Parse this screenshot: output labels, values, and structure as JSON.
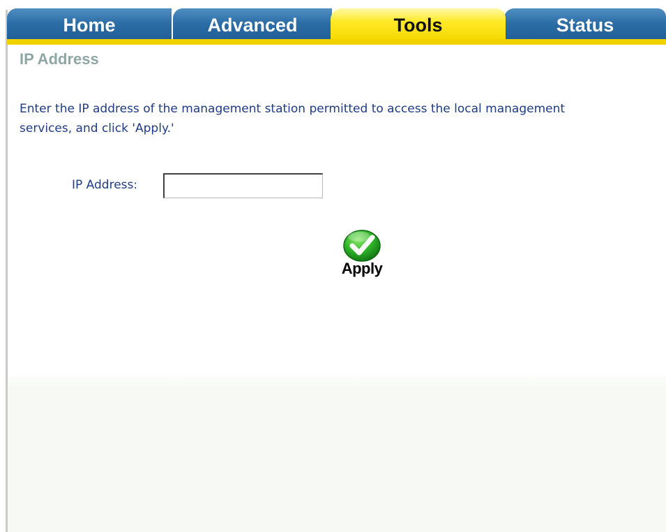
{
  "tabs": {
    "home": "Home",
    "advanced": "Advanced",
    "tools": "Tools",
    "status": "Status"
  },
  "active_tab": "Tools",
  "page": {
    "title": "IP Address",
    "instructions": "Enter the IP address of the management station permitted to access the local management services, and click 'Apply.'"
  },
  "form": {
    "ip_label": "IP Address:",
    "ip_value": "",
    "apply_label": "Apply"
  },
  "colors": {
    "tab_blue": "#2d6ea7",
    "tab_active_yellow": "#ffea2a",
    "accent_bar": "#f2d100",
    "title_gray": "#8fa7a3",
    "text_blue": "#1f3b86",
    "apply_green": "#2fb52a"
  },
  "icons": {
    "apply": "checkmark-circle-icon"
  }
}
